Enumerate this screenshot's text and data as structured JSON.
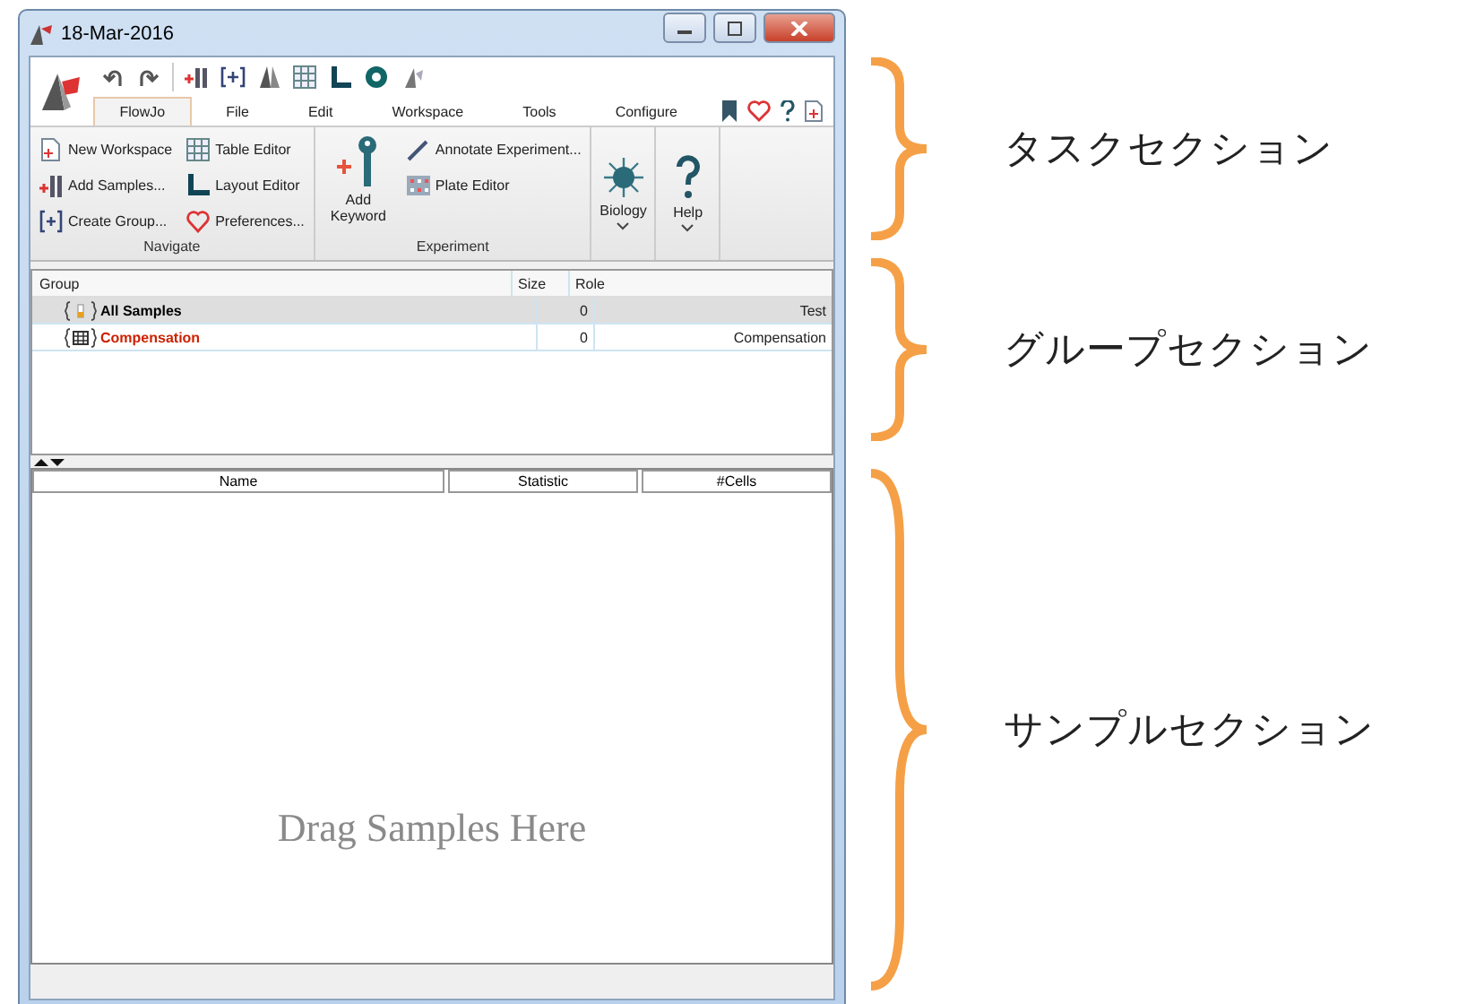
{
  "window": {
    "title": "18-Mar-2016"
  },
  "menu_tabs": [
    {
      "label": "FlowJo",
      "selected": true
    },
    {
      "label": "File",
      "selected": false
    },
    {
      "label": "Edit",
      "selected": false
    },
    {
      "label": "Workspace",
      "selected": false
    },
    {
      "label": "Tools",
      "selected": false
    },
    {
      "label": "Configure",
      "selected": false
    }
  ],
  "ribbon": {
    "groups": [
      {
        "label": "Navigate",
        "items": [
          {
            "label": "New Workspace",
            "kind": "small"
          },
          {
            "label": "Add Samples...",
            "kind": "small"
          },
          {
            "label": "Create Group...",
            "kind": "small"
          },
          {
            "label": "Table Editor",
            "kind": "small"
          },
          {
            "label": "Layout Editor",
            "kind": "small"
          },
          {
            "label": "Preferences...",
            "kind": "small"
          }
        ]
      },
      {
        "label": "Experiment",
        "items": [
          {
            "label": "Add Keyword",
            "kind": "large"
          },
          {
            "label": "Annotate Experiment...",
            "kind": "small"
          },
          {
            "label": "Plate Editor",
            "kind": "small"
          }
        ]
      }
    ],
    "dropdowns": [
      {
        "label": "Biology"
      },
      {
        "label": "Help"
      }
    ]
  },
  "groups_table": {
    "columns": [
      "Group",
      "Size",
      "Role"
    ],
    "rows": [
      {
        "name": "All Samples",
        "size": "0",
        "role": "Test",
        "selected": true,
        "color": "#000000"
      },
      {
        "name": "Compensation",
        "size": "0",
        "role": "Compensation",
        "selected": false,
        "color": "#cc2200"
      }
    ]
  },
  "samples_table": {
    "columns": [
      "Name",
      "Statistic",
      "#Cells"
    ],
    "placeholder": "Drag Samples Here"
  },
  "annotations": [
    {
      "label": "タスクセクション"
    },
    {
      "label": "グループセクション"
    },
    {
      "label": "サンプルセクション"
    }
  ]
}
